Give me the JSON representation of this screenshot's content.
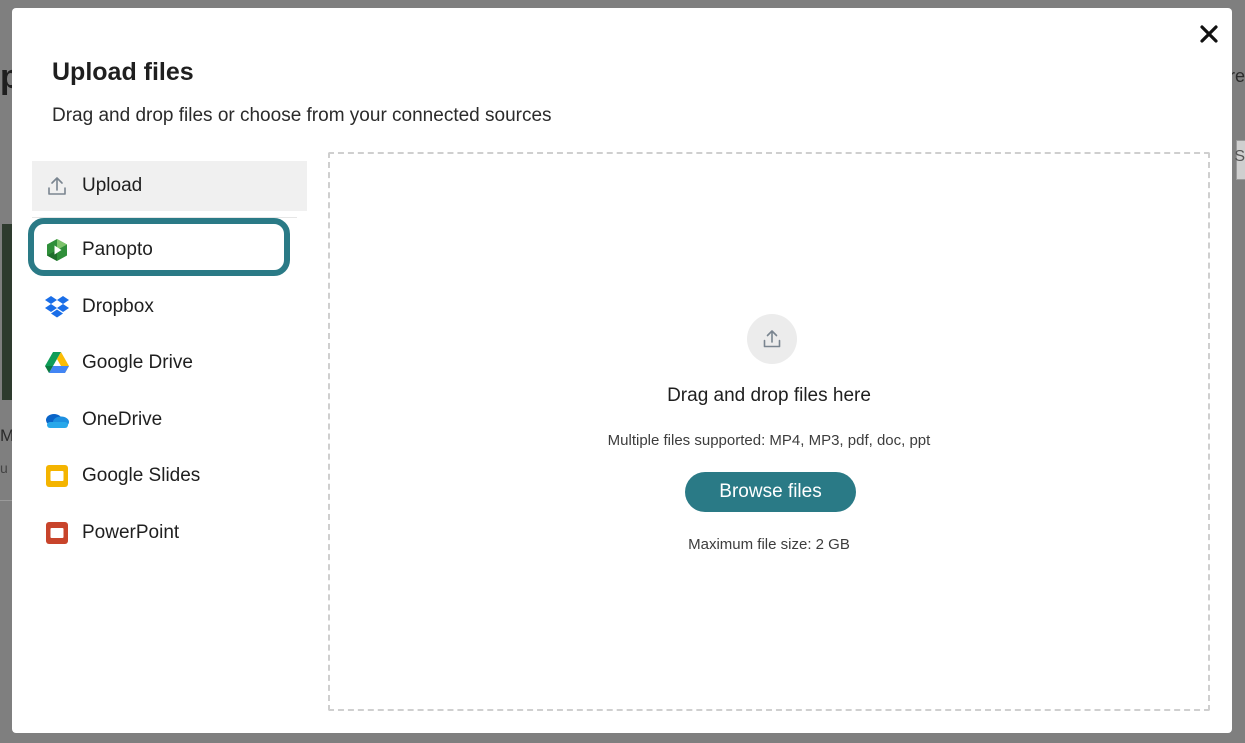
{
  "background": {
    "left_letter": "p",
    "right_text": "re",
    "right_box_letter": "S",
    "left_fragment_1": "M",
    "left_fragment_2": "u"
  },
  "dialog": {
    "title": "Upload files",
    "subtitle": "Drag and drop files or choose from your connected sources",
    "close_icon": "close-icon"
  },
  "sources": [
    {
      "label": "Upload",
      "icon": "upload-icon",
      "selected": true
    },
    {
      "label": "Panopto",
      "icon": "panopto-icon",
      "focused": true
    },
    {
      "label": "Dropbox",
      "icon": "dropbox-icon"
    },
    {
      "label": "Google Drive",
      "icon": "google-drive-icon"
    },
    {
      "label": "OneDrive",
      "icon": "onedrive-icon"
    },
    {
      "label": "Google Slides",
      "icon": "google-slides-icon"
    },
    {
      "label": "PowerPoint",
      "icon": "powerpoint-icon"
    }
  ],
  "dropzone": {
    "icon": "upload-icon",
    "title": "Drag and drop files here",
    "formats": "Multiple files supported: MP4, MP3, pdf, doc, ppt",
    "browse_label": "Browse files",
    "max_size": "Maximum file size: 2 GB"
  },
  "colors": {
    "accent": "#2a7a86",
    "overlay": "#7f7f7f",
    "selected_bg": "#f0f0f0"
  }
}
